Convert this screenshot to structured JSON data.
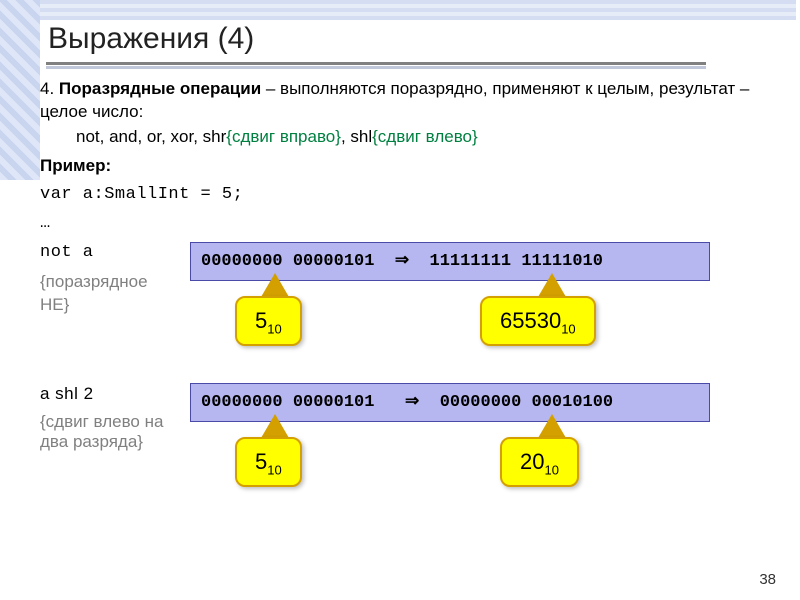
{
  "title": "Выражения (4)",
  "intro_num": "4.",
  "intro_bold": "Поразрядные операции",
  "intro_rest": " – выполняются поразрядно, применяют к целым, результат – целое число:",
  "ops_line_plain": "not, and, or, xor, shr ",
  "ops_shr": "{сдвиг вправо}",
  "ops_mid": ", shl ",
  "ops_shl": "{сдвиг влево}",
  "example_label": "Пример:",
  "var_decl": "var a:SmallInt = 5;",
  "ellipsis": "…",
  "ex1": {
    "expr": "not a",
    "note": "{поразрядное НЕ}",
    "bits_left": "00000000 00000101",
    "arrow": "⇒",
    "bits_right": "11111111 11111010",
    "c1_val": "5",
    "c1_sub": "10",
    "c2_val": "65530",
    "c2_sub": "10"
  },
  "ex2": {
    "expr": "a shl 2",
    "note": "{сдвиг влево  на два разряда}",
    "bits_left": "00000000 00000101",
    "arrow": "⇒",
    "bits_right": "00000000 00010100",
    "c1_val": "5",
    "c1_sub": "10",
    "c2_val": "20",
    "c2_sub": "10"
  },
  "page": "38"
}
